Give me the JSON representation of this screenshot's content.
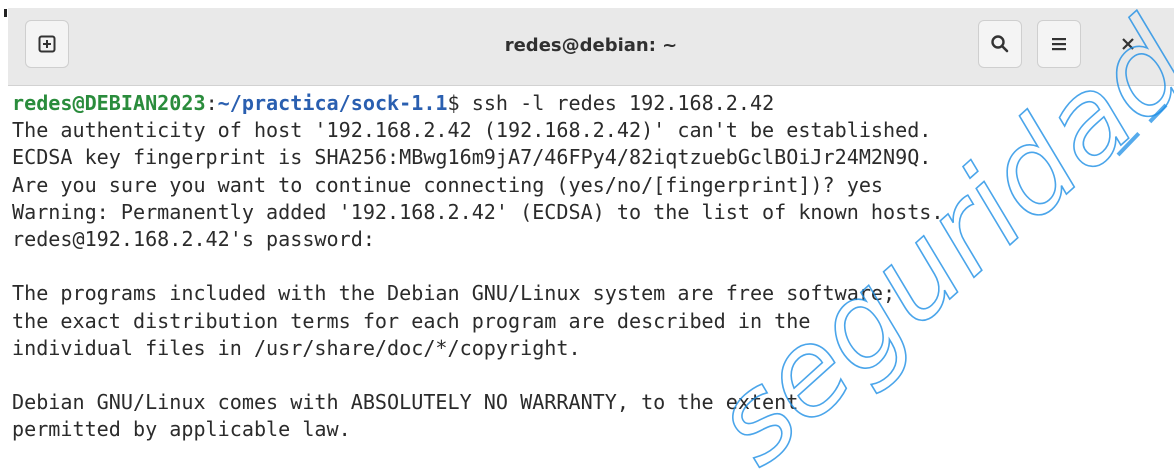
{
  "window": {
    "title": "redes@debian: ~"
  },
  "titlebar": {
    "icons": {
      "new_tab": "new-tab-icon",
      "search": "search-icon",
      "menu": "hamburger-menu-icon",
      "close": "close-icon"
    }
  },
  "terminal": {
    "prompt": {
      "user_host": "redes@DEBIAN2023",
      "separator": ":",
      "path": "~/practica/sock-1.1",
      "command": "$ ssh -l redes 192.168.2.42"
    },
    "output_lines": [
      "The authenticity of host '192.168.2.42 (192.168.2.42)' can't be established.",
      "ECDSA key fingerprint is SHA256:MBwg16m9jA7/46FPy4/82iqtzuebGclBOiJr24M2N9Q.",
      "Are you sure you want to continue connecting (yes/no/[fingerprint])? yes",
      "Warning: Permanently added '192.168.2.42' (ECDSA) to the list of known hosts.",
      "redes@192.168.2.42's password:",
      "",
      "The programs included with the Debian GNU/Linux system are free software;",
      "the exact distribution terms for each program are described in the",
      "individual files in /usr/share/doc/*/copyright.",
      "",
      "Debian GNU/Linux comes with ABSOLUTELY NO WARRANTY, to the extent",
      "permitted by applicable law."
    ]
  },
  "colors": {
    "prompt_user": "#2a8c3c",
    "prompt_path": "#2a5fb0",
    "text": "#2b2b2b",
    "titlebar": "#e9e9e9",
    "watermark": "#1e8fe6"
  },
  "watermark": {
    "text": "seguridad"
  }
}
